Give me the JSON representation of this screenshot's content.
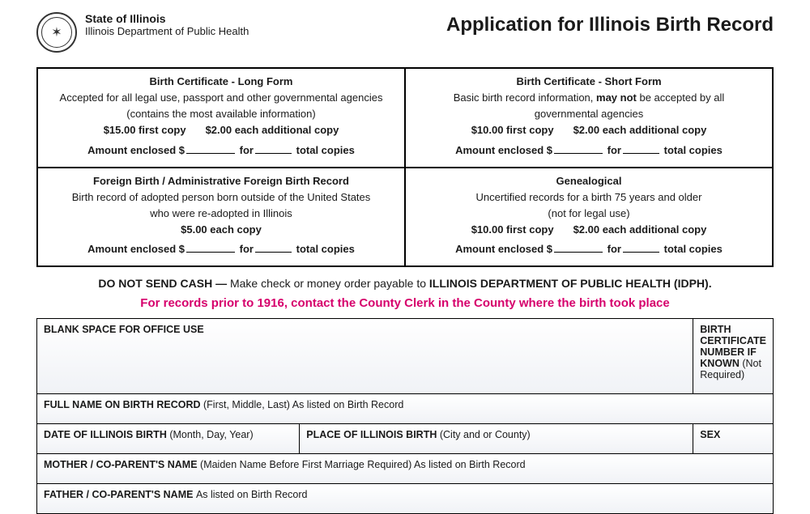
{
  "header": {
    "state_line1": "State of Illinois",
    "state_line2": "Illinois Department of Public Health",
    "title": "Application for Illinois Birth Record"
  },
  "options": [
    {
      "title": "Birth Certificate - Long Form",
      "desc_line1": "Accepted for all legal use, passport and other governmental agencies",
      "desc_line2": "(contains the most available information)",
      "price1": "$15.00 first copy",
      "price2": "$2.00 each additional copy",
      "amount_prefix": "Amount enclosed $",
      "amount_mid": "for",
      "amount_suffix": "total copies"
    },
    {
      "title": "Birth Certificate - Short Form",
      "desc_line1_a": "Basic birth record information, ",
      "desc_line1_b": "may not",
      "desc_line1_c": " be accepted by all",
      "desc_line2": "governmental agencies",
      "price1": "$10.00 first copy",
      "price2": "$2.00 each additional copy",
      "amount_prefix": "Amount enclosed $",
      "amount_mid": "for",
      "amount_suffix": "total copies"
    },
    {
      "title": "Foreign Birth / Administrative Foreign Birth Record",
      "desc_line1": "Birth record of adopted person born outside of the United States",
      "desc_line2": "who were re-adopted in Illinois",
      "price1": "$5.00 each copy",
      "price2": "",
      "amount_prefix": "Amount enclosed $",
      "amount_mid": "for",
      "amount_suffix": "total copies"
    },
    {
      "title": "Genealogical",
      "desc_line1": "Uncertified records for a birth 75 years and older",
      "desc_line2": "(not for legal use)",
      "price1": "$10.00 first copy",
      "price2": "$2.00 each additional copy",
      "amount_prefix": "Amount enclosed $",
      "amount_mid": "for",
      "amount_suffix": "total copies"
    }
  ],
  "no_cash": {
    "bold1": "DO NOT SEND CASH —",
    "text": " Make check or money order payable to ",
    "bold2": "ILLINOIS DEPARTMENT OF PUBLIC HEALTH (IDPH)."
  },
  "prior_note": "For records prior to 1916, contact the County Clerk in the County where the birth took place",
  "form": {
    "office_use": "BLANK SPACE FOR OFFICE USE",
    "cert_num_bold": "BIRTH CERTIFICATE NUMBER IF KNOWN ",
    "cert_num_light": "(Not Required)",
    "full_name_bold": "FULL NAME ON BIRTH RECORD ",
    "full_name_light": "(First, Middle, Last) As listed on Birth Record",
    "dob_bold": "DATE OF ILLINOIS BIRTH ",
    "dob_light": "(Month, Day, Year)",
    "place_bold": "PLACE OF ILLINOIS BIRTH ",
    "place_light": "(City and or County)",
    "sex": "SEX",
    "mother_bold": "MOTHER / CO-PARENT'S NAME ",
    "mother_light": "(Maiden Name Before First Marriage Required) As listed on Birth Record",
    "father_bold": "FATHER / CO-PARENT'S NAME ",
    "father_light": "As listed on Birth Record"
  }
}
